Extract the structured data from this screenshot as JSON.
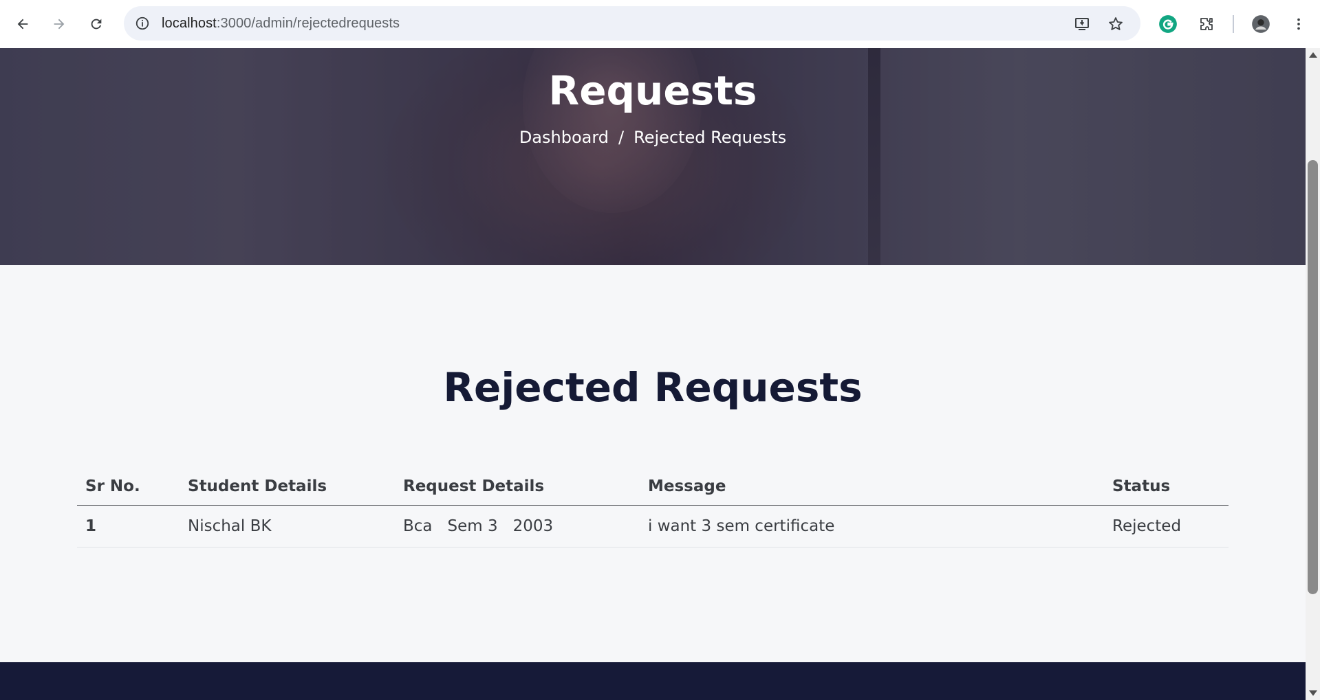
{
  "browser": {
    "url_host": "localhost",
    "url_path": ":3000/admin/rejectedrequests",
    "icons": {
      "back": "back-arrow-icon",
      "forward": "forward-arrow-icon",
      "reload": "reload-icon",
      "info": "site-info-icon",
      "install": "install-app-icon",
      "bookmark": "star-icon",
      "grammarly": "grammarly-icon",
      "extensions": "puzzle-icon",
      "profile": "avatar-icon",
      "menu": "kebab-menu-icon"
    }
  },
  "hero": {
    "title": "Requests",
    "breadcrumb": {
      "home": "Dashboard",
      "separator": "/",
      "current": "Rejected Requests"
    }
  },
  "section": {
    "title": "Rejected Requests"
  },
  "table": {
    "headers": [
      "Sr No.",
      "Student Details",
      "Request Details",
      "Message",
      "Status"
    ],
    "rows": [
      {
        "sr": "1",
        "student": "Nischal BK",
        "course": "Bca",
        "semester": "Sem 3",
        "year": "2003",
        "message": "i want 3 sem certificate",
        "status": "Rejected"
      }
    ]
  },
  "colors": {
    "page_bg": "#f6f7f9",
    "heading": "#151a35",
    "footer": "#161a38",
    "text": "#3a3d42"
  }
}
